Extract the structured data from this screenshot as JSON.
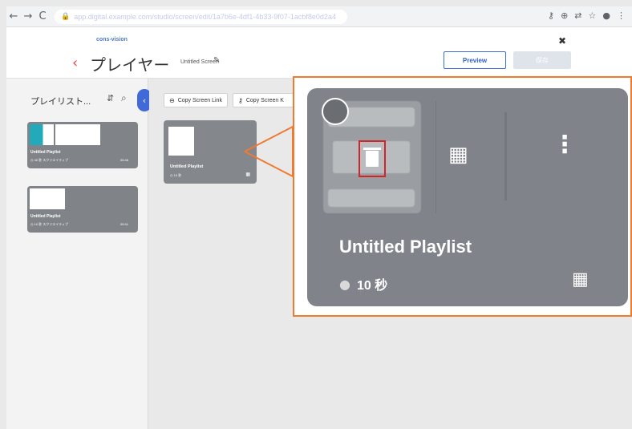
{
  "browser": {
    "url": "app.digital.example.com/studio/screen/edit/1a7b6e-4df1-4b33-9f07-1acbf8e0d2a4",
    "nav": [
      "←",
      "→",
      "C"
    ]
  },
  "header": {
    "logo_text": "cons-vision",
    "page_title": "プレイヤー",
    "screen_name": "Untitled Screen",
    "preview_label": "Preview",
    "save_label": "保存"
  },
  "sidebar": {
    "title": "プレイリスト...",
    "cards": [
      {
        "name": "Untitled Playlist",
        "meta": "◷ 40 秒  スクリエイティブ",
        "time": "05:46"
      },
      {
        "name": "Untitled Playlist",
        "meta": "◷ 10 秒  スクリエイティブ",
        "time": "05:41"
      }
    ]
  },
  "toolbar": {
    "copy_link": "Copy Screen Link",
    "copy_key": "Copy Screen K"
  },
  "main_card": {
    "name": "Untitled Playlist",
    "meta": "◷ 10 秒"
  },
  "callout": {
    "name": "Untitled Playlist",
    "duration": "10 秒",
    "accent_color": "#f07a30",
    "highlight_color": "#d42428"
  }
}
